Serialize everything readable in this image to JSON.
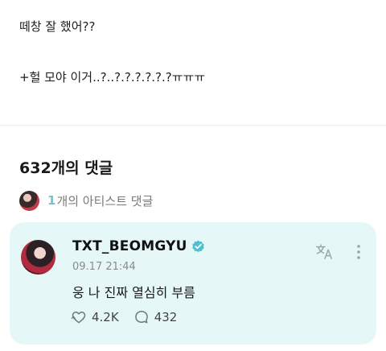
{
  "post": {
    "line1": "떼창 잘 했어??",
    "line2": "+헐 모야 이거..?..?.?.?.?.?.?ㅠㅠㅠ"
  },
  "comments": {
    "header": "632개의 댓글",
    "artist_count": "1",
    "artist_label": "개의 아티스트 댓글"
  },
  "comment": {
    "username": "TXT_BEOMGYU",
    "timestamp": "09.17 21:44",
    "text": "웅 나 진짜 열심히 부름",
    "likes": "4.2K",
    "replies": "432",
    "verified": true
  },
  "colors": {
    "accent": "#6bc9d6",
    "card_bg": "#e6f7f8",
    "verified_badge": "#4fc0d0"
  },
  "icons": [
    "verified-badge-icon",
    "translate-icon",
    "more-vertical-icon",
    "like-icon",
    "reply-icon"
  ]
}
